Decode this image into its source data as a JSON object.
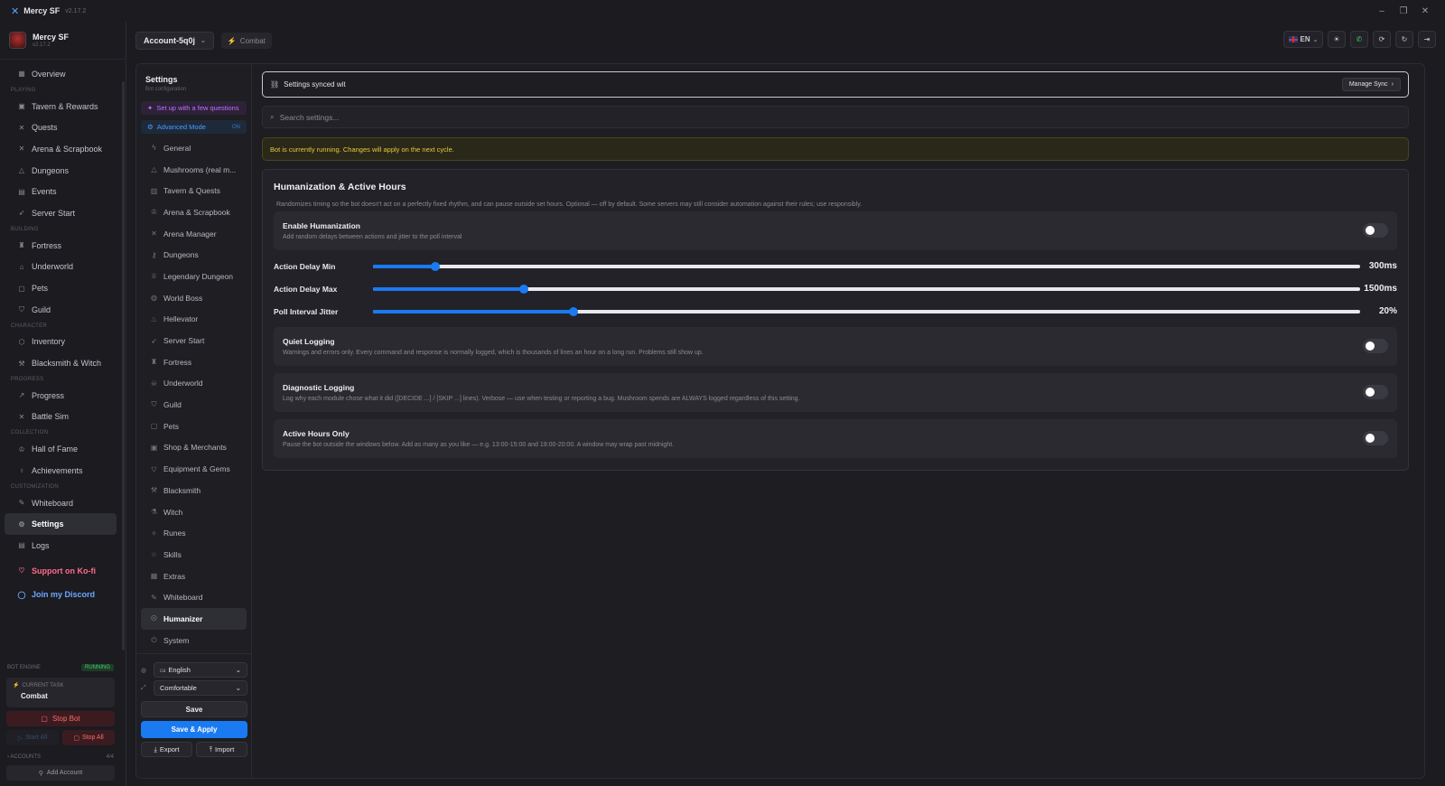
{
  "window": {
    "title": "Mercy SF",
    "version": "v2.17.2"
  },
  "brand": {
    "name": "Mercy SF",
    "version": "v2.17.2"
  },
  "nav": {
    "overview": "Overview",
    "sec_playing": "PLAYING",
    "tavern": "Tavern & Rewards",
    "quests": "Quests",
    "arena": "Arena & Scrapbook",
    "dungeons": "Dungeons",
    "events": "Events",
    "server_start": "Server Start",
    "sec_building": "BUILDING",
    "fortress": "Fortress",
    "underworld": "Underworld",
    "pets": "Pets",
    "guild": "Guild",
    "sec_character": "CHARACTER",
    "inventory": "Inventory",
    "blacksmith": "Blacksmith & Witch",
    "sec_progress": "PROGRESS",
    "progress": "Progress",
    "battle_sim": "Battle Sim",
    "sec_collection": "COLLECTION",
    "hall_of_fame": "Hall of Fame",
    "achievements": "Achievements",
    "sec_customization": "CUSTOMIZATION",
    "whiteboard": "Whiteboard",
    "settings": "Settings",
    "logs": "Logs",
    "kofi": "Support on Ko-fi",
    "discord": "Join my Discord"
  },
  "engine": {
    "label": "BOT ENGINE",
    "status": "RUNNING",
    "task_label": "CURRENT TASK",
    "task_value": "Combat",
    "stop_bot": "Stop Bot",
    "start_all": "Start All",
    "stop_all": "Stop All",
    "accounts_label": "ACCOUNTS",
    "accounts_count": "4/4",
    "add_account": "Add Account"
  },
  "header": {
    "account": "Account-5q0j",
    "combat_tag": "Combat",
    "lang": "EN"
  },
  "settings_nav": {
    "title": "Settings",
    "subtitle": "Bot configuration",
    "wizard": "Set up with a few questions",
    "advanced": "Advanced Mode",
    "advanced_state": "ON",
    "items": [
      "General",
      "Mushrooms (real m...",
      "Tavern & Quests",
      "Arena & Scrapbook",
      "Arena Manager",
      "Dungeons",
      "Legendary Dungeon",
      "World Boss",
      "Hellevator",
      "Server Start",
      "Fortress",
      "Underworld",
      "Guild",
      "Pets",
      "Shop & Merchants",
      "Equipment & Gems",
      "Blacksmith",
      "Witch",
      "Runes",
      "Skills",
      "Extras",
      "Whiteboard",
      "Humanizer",
      "System"
    ],
    "language": "English",
    "density": "Comfortable",
    "save": "Save",
    "save_apply": "Save & Apply",
    "export": "Export",
    "import": "Import"
  },
  "content": {
    "sync_text": "Settings synced wit",
    "manage_sync": "Manage Sync",
    "search_placeholder": "Search settings...",
    "warning": "Bot is currently running. Changes will apply on the next cycle.",
    "section_title": "Humanization & Active Hours",
    "section_desc": "Randomizes timing so the bot doesn't act on a perfectly fixed rhythm, and can pause outside set hours. Optional — off by default. Some servers may still consider automation against their rules; use responsibly.",
    "enable_title": "Enable Humanization",
    "enable_desc": "Add random delays between actions and jitter to the poll interval",
    "sliders": [
      {
        "label": "Action Delay Min",
        "value": "300ms",
        "fraction": 0.063
      },
      {
        "label": "Action Delay Max",
        "value": "1500ms",
        "fraction": 0.153
      },
      {
        "label": "Poll Interval Jitter",
        "value": "20%",
        "fraction": 0.203
      }
    ],
    "quiet_title": "Quiet Logging",
    "quiet_desc": "Warnings and errors only. Every command and response is normally logged, which is thousands of lines an hour on a long run. Problems still show up.",
    "diag_title": "Diagnostic Logging",
    "diag_desc": "Log why each module chose what it did ([DECIDE ...] / [SKIP ...] lines). Verbose — use when testing or reporting a bug. Mushroom spends are ALWAYS logged regardless of this setting.",
    "active_title": "Active Hours Only",
    "active_desc": "Pause the bot outside the windows below. Add as many as you like — e.g. 13:00-15:00 and 19:00-20:00. A window may wrap past midnight."
  },
  "colors": {
    "accent": "#1a7af2",
    "running": "#3ed06a",
    "warning": "#e8c840",
    "danger": "#ff6a6a",
    "kofi": "#ff6b8a"
  }
}
